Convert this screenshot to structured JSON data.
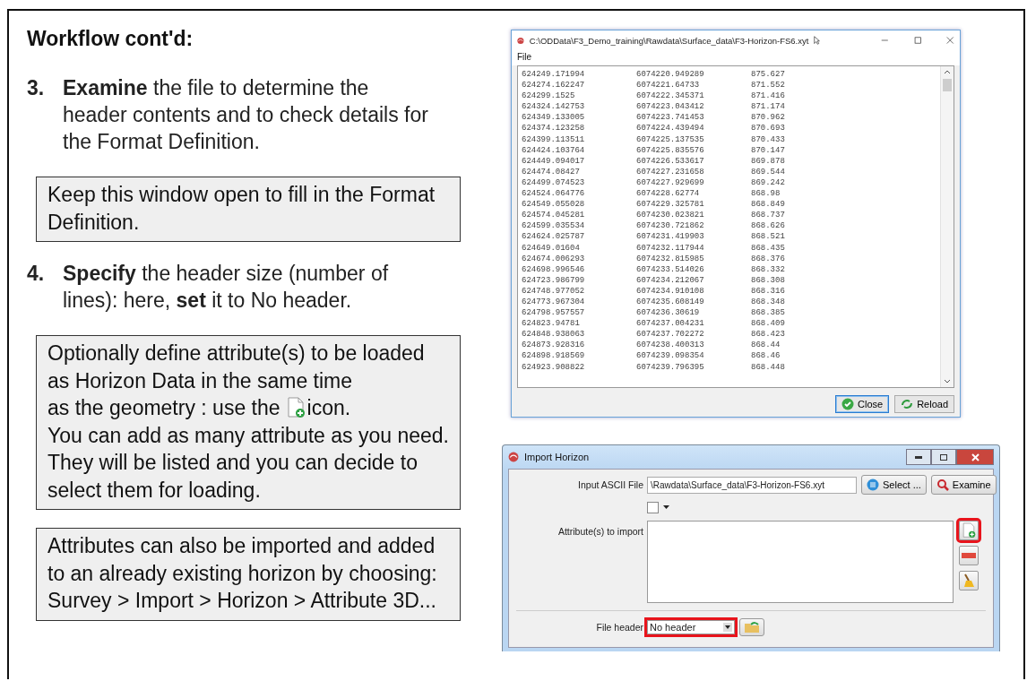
{
  "slide": {
    "title": "Workflow cont'd:",
    "items": [
      {
        "kind": "step",
        "number": "3.",
        "text": "**Examine** the file to determine the header contents and to check details for the Format Definition."
      },
      {
        "kind": "note",
        "text": "Keep this window open to fill in the Format Definition."
      },
      {
        "kind": "step",
        "number": "4.",
        "text": "**Specify** the header size (number of lines): here, **set** it to No header."
      },
      {
        "kind": "note",
        "text": "Optionally define attribute(s) to be loaded as Horizon Data in the same time",
        "icon_line": "as the geometry : use the",
        "icon_text": "icon.",
        "more_text": "You can add as many attribute as you need. They will be listed and you can decide to select them for loading."
      },
      {
        "kind": "note",
        "text": "Attributes can also be imported and added to an already existing horizon by choosing: Survey > Import > Horizon > Attribute 3D..."
      }
    ]
  },
  "examine_window": {
    "title": "C:\\ODData\\F3_Demo_training\\Rawdata\\Surface_data\\F3-Horizon-FS6.xyt",
    "menu": [
      "File"
    ],
    "rows": [
      [
        "624249.171994",
        "6074220.949289",
        "875.627"
      ],
      [
        "624274.162247",
        "6074221.64733",
        "871.552"
      ],
      [
        "624299.1525",
        "6074222.345371",
        "871.416"
      ],
      [
        "624324.142753",
        "6074223.043412",
        "871.174"
      ],
      [
        "624349.133005",
        "6074223.741453",
        "870.962"
      ],
      [
        "624374.123258",
        "6074224.439494",
        "870.693"
      ],
      [
        "624399.113511",
        "6074225.137535",
        "870.433"
      ],
      [
        "624424.103764",
        "6074225.835576",
        "870.147"
      ],
      [
        "624449.094017",
        "6074226.533617",
        "869.878"
      ],
      [
        "624474.08427",
        "6074227.231658",
        "869.544"
      ],
      [
        "624499.074523",
        "6074227.929699",
        "869.242"
      ],
      [
        "624524.064776",
        "6074228.62774",
        "868.98"
      ],
      [
        "624549.055028",
        "6074229.325781",
        "868.849"
      ],
      [
        "624574.045281",
        "6074230.023821",
        "868.737"
      ],
      [
        "624599.035534",
        "6074230.721862",
        "868.626"
      ],
      [
        "624624.025787",
        "6074231.419903",
        "868.521"
      ],
      [
        "624649.01604",
        "6074232.117944",
        "868.435"
      ],
      [
        "624674.006293",
        "6074232.815985",
        "868.376"
      ],
      [
        "624698.996546",
        "6074233.514026",
        "868.332"
      ],
      [
        "624723.986799",
        "6074234.212067",
        "868.308"
      ],
      [
        "624748.977052",
        "6074234.910108",
        "868.316"
      ],
      [
        "624773.967304",
        "6074235.608149",
        "868.348"
      ],
      [
        "624798.957557",
        "6074236.30619",
        "868.385"
      ],
      [
        "624823.94781",
        "6074237.004231",
        "868.409"
      ],
      [
        "624848.938063",
        "6074237.702272",
        "868.423"
      ],
      [
        "624873.928316",
        "6074238.400313",
        "868.44"
      ],
      [
        "624898.918569",
        "6074239.098354",
        "868.46"
      ],
      [
        "624923.908822",
        "6074239.796395",
        "868.448"
      ]
    ],
    "buttons": [
      {
        "label": "Close",
        "kind": "close",
        "selected": true
      },
      {
        "label": "Reload",
        "kind": "reload",
        "selected": false
      }
    ]
  },
  "import_window": {
    "title": "Import Horizon",
    "input_file": {
      "label": "Input ASCII File",
      "value": "\\Rawdata\\Surface_data\\F3-Horizon-FS6.xyt"
    },
    "buttons": [
      {
        "label": "Select ...",
        "kind": "select"
      },
      {
        "label": "Examine",
        "kind": "examine"
      }
    ],
    "checkbox": {
      "checked": false
    },
    "attributes": {
      "label": "Attribute(s) to import"
    },
    "tools": [
      {
        "kind": "add",
        "highlighted": true
      },
      {
        "kind": "remove",
        "highlighted": false
      },
      {
        "kind": "clear",
        "highlighted": false
      }
    ],
    "file_header": {
      "label": "File header",
      "value": "No header",
      "highlighted": true
    }
  }
}
